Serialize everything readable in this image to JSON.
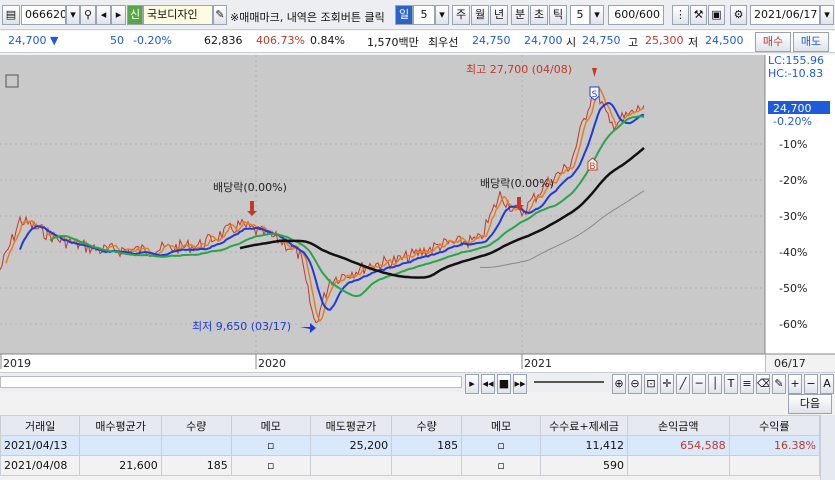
{
  "toolbar": {
    "code": "066620",
    "badge": "신",
    "name": "국보디자인",
    "hint": "※매매마크, 내역은 조회버튼 클릭",
    "period_day": "일",
    "period_day_n": "5",
    "week": "주",
    "month": "월",
    "year": "년",
    "minute": "분",
    "second": "초",
    "tick": "틱",
    "tick_n": "5",
    "count": "600/600",
    "date": "2021/06/17"
  },
  "quote": {
    "price": "24,700",
    "change": "50",
    "change_pct": "-0.20%",
    "volume": "62,836",
    "vol_ratio": "406.73%",
    "turnover": "0.84%",
    "amount": "1,570백만",
    "best_label": "최우선",
    "best_ask": "24,750",
    "best_bid": "24,700",
    "open_label": "시",
    "open": "24,750",
    "high_label": "고",
    "high": "25,300",
    "low_label": "저",
    "low": "24,500",
    "buy": "매수",
    "sell": "매도"
  },
  "chart": {
    "max_label": "최고 27,700 (04/08)",
    "min_label": "최저 9,650 (03/17)",
    "div1": "배당락(0.00%)",
    "div2": "배당락(0.00%)",
    "lc": "LC:155.96",
    "hc": "HC:-10.83",
    "cur_price": "24,700",
    "cur_pct": "-0.20%",
    "axis": [
      "-10%",
      "-20%",
      "-30%",
      "-40%",
      "-50%",
      "-60%"
    ],
    "dates": [
      "2019",
      "2020",
      "2021",
      "06/17"
    ],
    "mark_sell": "S",
    "mark_buy": "B"
  },
  "colors": {
    "price": "#c0392b",
    "ma5": "#e67e22",
    "ma20": "#1f3bd6",
    "ma60": "#2aa34a",
    "ma120": "#111111",
    "ma240": "#888888",
    "accent": "#1e5bd8"
  },
  "nav": {
    "next": "다음"
  },
  "table": {
    "headers": [
      "거래일",
      "매수평균가",
      "수량",
      "메모",
      "매도평균가",
      "수량",
      "메모",
      "수수료+제세금",
      "손익금액",
      "수익률"
    ],
    "rows": [
      [
        "2021/04/13",
        "",
        "",
        "",
        "25,200",
        "185",
        "",
        "11,412",
        "654,588",
        "16.38%"
      ],
      [
        "2021/04/08",
        "21,600",
        "185",
        "",
        "",
        "",
        "",
        "590",
        "",
        ""
      ]
    ]
  }
}
